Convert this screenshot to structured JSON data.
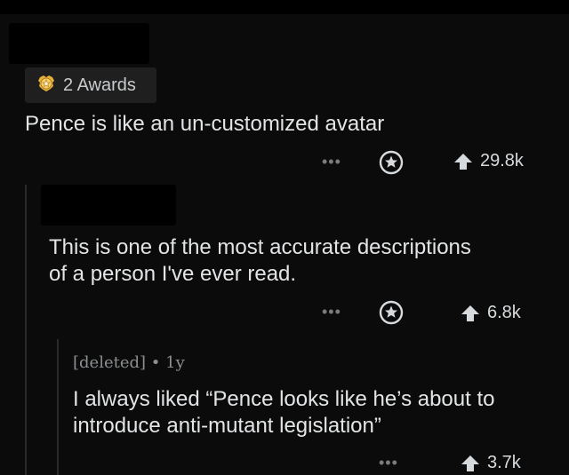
{
  "comment1": {
    "awards_label": "2 Awards",
    "text": "Pence is like an un-customized avatar",
    "more": "•••",
    "score": "29.8k"
  },
  "comment2": {
    "text_line1": "This is one of the most accurate descriptions",
    "text_line2": "of a person I've ever read.",
    "more": "•••",
    "score": "6.8k"
  },
  "comment3": {
    "author": "[deleted]",
    "separator": "•",
    "age": "1y",
    "text_line1": "I always liked “Pence looks like he’s about to",
    "text_line2": "introduce anti-mutant legislation”",
    "more": "•••",
    "score": "3.7k"
  }
}
